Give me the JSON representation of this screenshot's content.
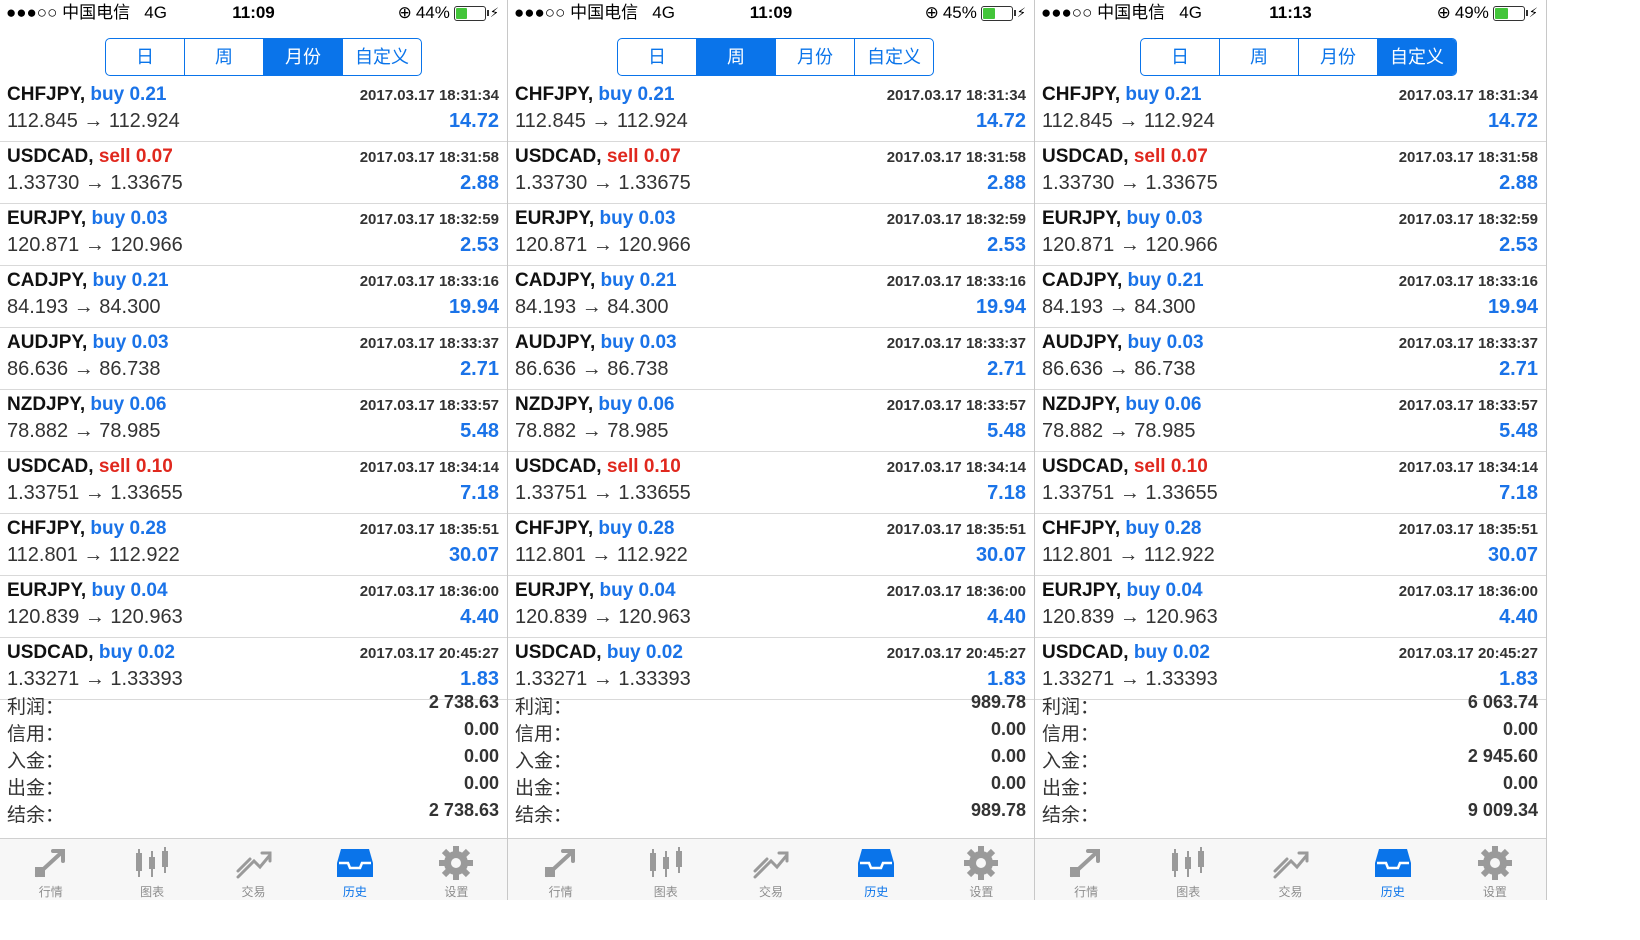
{
  "panels": [
    {
      "status": {
        "carrier": "●●●○○ 中国电信",
        "network": "4G",
        "time": "11:09",
        "battery_pct": "44%",
        "battery_level": 0.44,
        "rotation_lock": "⊕"
      },
      "active_tab": 2,
      "summary": [
        {
          "label": "利润：",
          "value": "2 738.63"
        },
        {
          "label": "信用：",
          "value": "0.00"
        },
        {
          "label": "入金：",
          "value": "0.00"
        },
        {
          "label": "出金：",
          "value": "0.00"
        },
        {
          "label": "结余：",
          "value": "2 738.63"
        }
      ]
    },
    {
      "status": {
        "carrier": "●●●○○ 中国电信",
        "network": "4G",
        "time": "11:09",
        "battery_pct": "45%",
        "battery_level": 0.45,
        "rotation_lock": "⊕"
      },
      "active_tab": 1,
      "summary": [
        {
          "label": "利润：",
          "value": "989.78"
        },
        {
          "label": "信用：",
          "value": "0.00"
        },
        {
          "label": "入金：",
          "value": "0.00"
        },
        {
          "label": "出金：",
          "value": "0.00"
        },
        {
          "label": "结余：",
          "value": "989.78"
        }
      ]
    },
    {
      "status": {
        "carrier": "●●●○○ 中国电信",
        "network": "4G",
        "time": "11:13",
        "battery_pct": "49%",
        "battery_level": 0.49,
        "rotation_lock": "⊕"
      },
      "active_tab": 3,
      "summary": [
        {
          "label": "利润：",
          "value": "6 063.74"
        },
        {
          "label": "信用：",
          "value": "0.00"
        },
        {
          "label": "入金：",
          "value": "2 945.60"
        },
        {
          "label": "出金：",
          "value": "0.00"
        },
        {
          "label": "结余：",
          "value": "9 009.34"
        }
      ]
    }
  ],
  "period_tabs": [
    "日",
    "周",
    "月份",
    "自定义"
  ],
  "trades": [
    {
      "symbol": "CHFJPY,",
      "side": "buy",
      "lots": "0.21",
      "time": "2017.03.17 18:31:34",
      "prices": "112.845 → 112.924",
      "profit": "14.72"
    },
    {
      "symbol": "USDCAD,",
      "side": "sell",
      "lots": "0.07",
      "time": "2017.03.17 18:31:58",
      "prices": "1.33730 → 1.33675",
      "profit": "2.88"
    },
    {
      "symbol": "EURJPY,",
      "side": "buy",
      "lots": "0.03",
      "time": "2017.03.17 18:32:59",
      "prices": "120.871 → 120.966",
      "profit": "2.53"
    },
    {
      "symbol": "CADJPY,",
      "side": "buy",
      "lots": "0.21",
      "time": "2017.03.17 18:33:16",
      "prices": "84.193 → 84.300",
      "profit": "19.94"
    },
    {
      "symbol": "AUDJPY,",
      "side": "buy",
      "lots": "0.03",
      "time": "2017.03.17 18:33:37",
      "prices": "86.636 → 86.738",
      "profit": "2.71"
    },
    {
      "symbol": "NZDJPY,",
      "side": "buy",
      "lots": "0.06",
      "time": "2017.03.17 18:33:57",
      "prices": "78.882 → 78.985",
      "profit": "5.48"
    },
    {
      "symbol": "USDCAD,",
      "side": "sell",
      "lots": "0.10",
      "time": "2017.03.17 18:34:14",
      "prices": "1.33751 → 1.33655",
      "profit": "7.18"
    },
    {
      "symbol": "CHFJPY,",
      "side": "buy",
      "lots": "0.28",
      "time": "2017.03.17 18:35:51",
      "prices": "112.801 → 112.922",
      "profit": "30.07"
    },
    {
      "symbol": "EURJPY,",
      "side": "buy",
      "lots": "0.04",
      "time": "2017.03.17 18:36:00",
      "prices": "120.839 → 120.963",
      "profit": "4.40"
    },
    {
      "symbol": "USDCAD,",
      "side": "buy",
      "lots": "0.02",
      "time": "2017.03.17 20:45:27",
      "prices": "1.33271 → 1.33393",
      "profit": "1.83"
    }
  ],
  "bottom_tabs": [
    {
      "label": "行情",
      "icon": "quotes-icon"
    },
    {
      "label": "图表",
      "icon": "chart-candles-icon"
    },
    {
      "label": "交易",
      "icon": "trade-icon"
    },
    {
      "label": "历史",
      "icon": "history-icon"
    },
    {
      "label": "设置",
      "icon": "settings-gear-icon"
    }
  ],
  "active_bottom_tab": 3,
  "colors": {
    "accent": "#0a74ea",
    "buy": "#1a73e8",
    "sell": "#e0281e",
    "profit": "#1a73e8",
    "battery": "#43c53a"
  }
}
